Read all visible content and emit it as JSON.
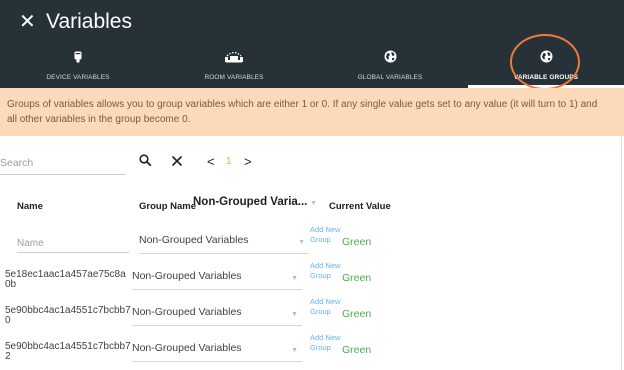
{
  "window": {
    "close_icon": "close-icon",
    "title": "Variables"
  },
  "tabs": [
    {
      "label": "DEVICE VARIABLES",
      "icon": "device-icon",
      "active": false
    },
    {
      "label": "ROOM VARIABLES",
      "icon": "room-icon",
      "active": false
    },
    {
      "label": "GLOBAL VARIABLES",
      "icon": "globe-icon",
      "active": false
    },
    {
      "label": "VARIABLE GROUPS",
      "icon": "globe-icon",
      "active": true
    }
  ],
  "notice": "Groups of variables allows you to group variables which are either 1 or 0. If any single value gets set to any value (it will turn to 1) and all other variables in the group become 0.",
  "toolbar": {
    "search_placeholder": "Search",
    "search_icon": "search-icon",
    "clear_icon": "close-icon",
    "prev": "<",
    "page": "1",
    "next": ">"
  },
  "table": {
    "headers": {
      "name": "Name",
      "group_name": "Group Name",
      "group_filter": "Non-Grouped Varia...",
      "current_value": "Current Value"
    },
    "new_row": {
      "name_placeholder": "Name",
      "group": "Non-Grouped Variables",
      "add_new_group": "Add New Group",
      "current_value": "Green"
    },
    "rows": [
      {
        "name": "5e18ec1aac1a457ae75c8a0b",
        "group": "Non-Grouped Variables",
        "add_new_group": "Add New Group",
        "current_value": "Green"
      },
      {
        "name": "5e90bbc4ac1a4551c7bcbb70",
        "group": "Non-Grouped Variables",
        "add_new_group": "Add New Group",
        "current_value": "Green"
      },
      {
        "name": "5e90bbc4ac1a4551c7bcbb72",
        "group": "Non-Grouped Variables",
        "add_new_group": "Add New Group",
        "current_value": "Green"
      }
    ]
  },
  "colors": {
    "topbar": "#263238",
    "notice_bg": "#fcd9b9",
    "highlight_ring": "#f2793a",
    "link": "#64b5f6",
    "value_green": "#4caf50",
    "pager_active": "#f5a623"
  }
}
